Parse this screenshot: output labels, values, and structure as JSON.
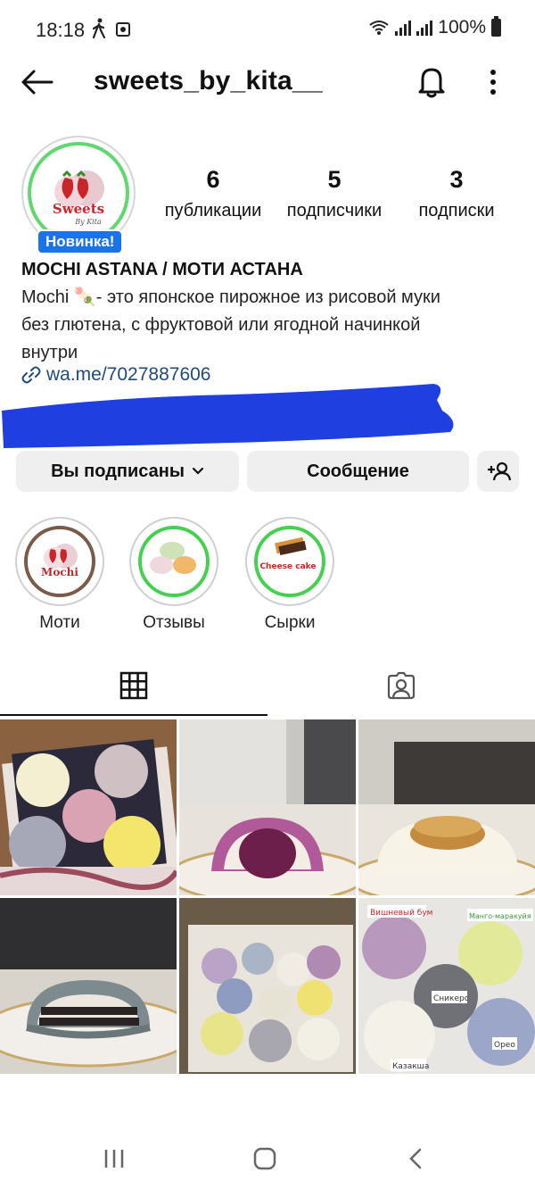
{
  "status_bar": {
    "time": "18:18",
    "battery": "100%"
  },
  "header": {
    "username": "sweets_by_kita__"
  },
  "profile": {
    "avatar_badge": "Новинка!",
    "stats": [
      {
        "value": "6",
        "label": "публикации"
      },
      {
        "value": "5",
        "label": "подписчики"
      },
      {
        "value": "3",
        "label": "подписки"
      }
    ],
    "display_name": "MOCHI ASTANA / МОТИ АСТАНА",
    "bio_lines": [
      "Mochi 🍡- это японское пирожное из рисовой муки",
      "без глютена, с фруктовой или ягодной начинкой",
      "внутри"
    ],
    "link": "wa.me/7027887606",
    "logo_text": "Sweets",
    "logo_sub": "By Kita"
  },
  "actions": {
    "following_label": "Вы подписаны",
    "message_label": "Сообщение"
  },
  "highlights": [
    {
      "label": "Моти",
      "cover_text": "Mochi"
    },
    {
      "label": "Отзывы",
      "cover_text": ""
    },
    {
      "label": "Сырки",
      "cover_text": "Cheese cake"
    }
  ],
  "posts": [
    {
      "caption": ""
    },
    {
      "caption": ""
    },
    {
      "caption": ""
    },
    {
      "caption": ""
    },
    {
      "caption": ""
    },
    {
      "labels": [
        "Вишневый бум",
        "Манго-маракуйя",
        "Сникерс",
        "Орео",
        "Казакша"
      ]
    }
  ],
  "colors": {
    "accent_blue": "#1a73e8",
    "story_green": "#5fd86f",
    "link": "#1f4a7d",
    "scribble": "#1f3fe0"
  }
}
